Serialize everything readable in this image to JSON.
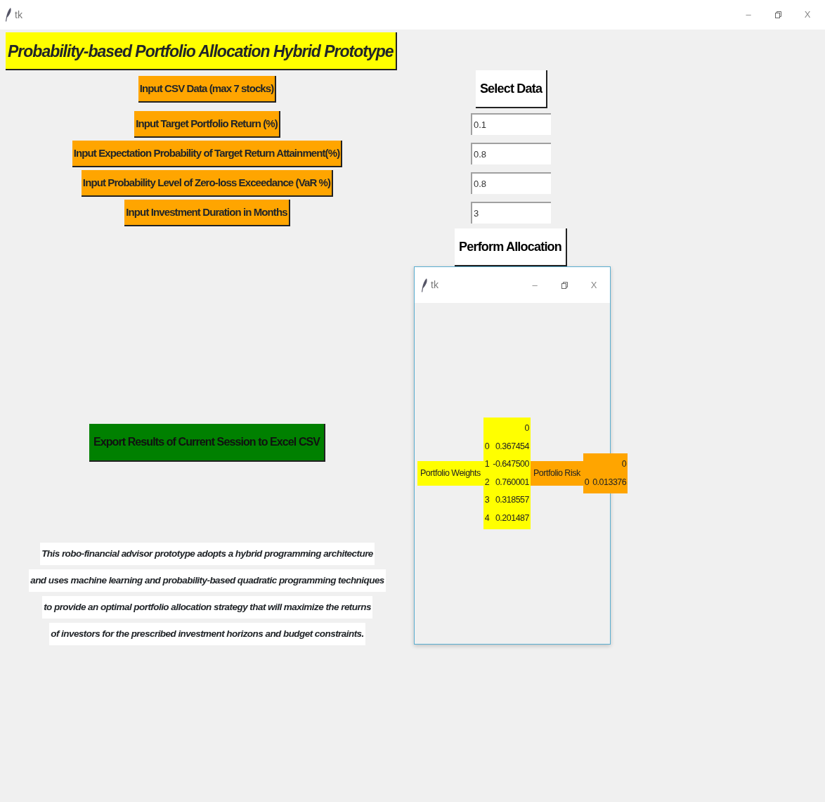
{
  "window": {
    "title": "tk",
    "minimize": "–",
    "close": "X"
  },
  "header": "Probability-based Portfolio Allocation Hybrid Prototype",
  "labels": [
    "Input CSV Data (max 7 stocks)",
    "Input Target Portfolio Return (%)",
    "Input Expectation Probability of Target Return Attainment(%)",
    "Input Probability Level of Zero-loss Exceedance (VaR %)",
    "Input Investment Duration in Months"
  ],
  "select_button": "Select Data",
  "fields": [
    {
      "value": "0.1"
    },
    {
      "value": "0.8"
    },
    {
      "value": "0.8"
    },
    {
      "value": "3"
    }
  ],
  "perform_button": "Perform Allocation",
  "export_button": "Export Results of Current Session to Excel CSV",
  "description": [
    "This robo-financial advisor prototype adopts a hybrid programming architecture",
    "and uses machine learning and probability-based quadratic programming techniques",
    "to provide an optimal portfolio allocation strategy that will maximize the returns",
    "of investors for the prescribed investment horizons and budget constraints."
  ],
  "result_window": {
    "title": "tk",
    "minimize": "–",
    "close": "X",
    "weights_label": "Portfolio Weights",
    "weights_table": {
      "header": "0",
      "rows": [
        {
          "index": "0",
          "value": "0.367454"
        },
        {
          "index": "1",
          "value": "-0.647500"
        },
        {
          "index": "2",
          "value": "0.760001"
        },
        {
          "index": "3",
          "value": "0.318557"
        },
        {
          "index": "4",
          "value": "0.201487"
        }
      ]
    },
    "risk_label": "Portfolio Risk",
    "risk_table": {
      "header": "0",
      "rows": [
        {
          "index": "0",
          "value": "0.013376"
        }
      ]
    }
  }
}
